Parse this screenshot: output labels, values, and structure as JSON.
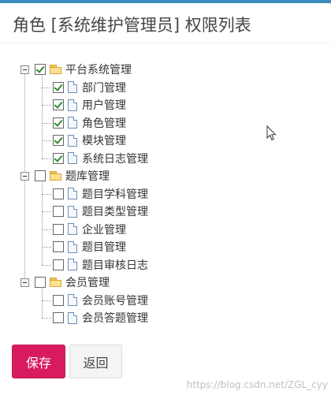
{
  "panel": {
    "title": "角色 [系统维护管理员] 权限列表",
    "accent_color": "#3c8dbc"
  },
  "tree": [
    {
      "label": "平台系统管理",
      "checked": true,
      "expanded": true,
      "icon": "folder-icon",
      "children": [
        {
          "label": "部门管理",
          "checked": true,
          "icon": "file-icon"
        },
        {
          "label": "用户管理",
          "checked": true,
          "icon": "file-icon"
        },
        {
          "label": "角色管理",
          "checked": true,
          "icon": "file-icon"
        },
        {
          "label": "模块管理",
          "checked": true,
          "icon": "file-icon"
        },
        {
          "label": "系统日志管理",
          "checked": true,
          "icon": "file-icon"
        }
      ]
    },
    {
      "label": "题库管理",
      "checked": false,
      "expanded": true,
      "icon": "folder-icon",
      "children": [
        {
          "label": "题目学科管理",
          "checked": false,
          "icon": "file-icon"
        },
        {
          "label": "题目类型管理",
          "checked": false,
          "icon": "file-icon"
        },
        {
          "label": "企业管理",
          "checked": false,
          "icon": "file-icon"
        },
        {
          "label": "题目管理",
          "checked": false,
          "icon": "file-icon"
        },
        {
          "label": "题目审核日志",
          "checked": false,
          "icon": "file-icon"
        }
      ]
    },
    {
      "label": "会员管理",
      "checked": false,
      "expanded": true,
      "icon": "folder-icon",
      "children": [
        {
          "label": "会员账号管理",
          "checked": false,
          "icon": "file-icon"
        },
        {
          "label": "会员答题管理",
          "checked": false,
          "icon": "file-icon"
        }
      ]
    }
  ],
  "buttons": {
    "save_label": "保存",
    "back_label": "返回",
    "save_color": "#d81b60"
  },
  "watermark": "https://blog.csdn.net/ZGL_cyy"
}
